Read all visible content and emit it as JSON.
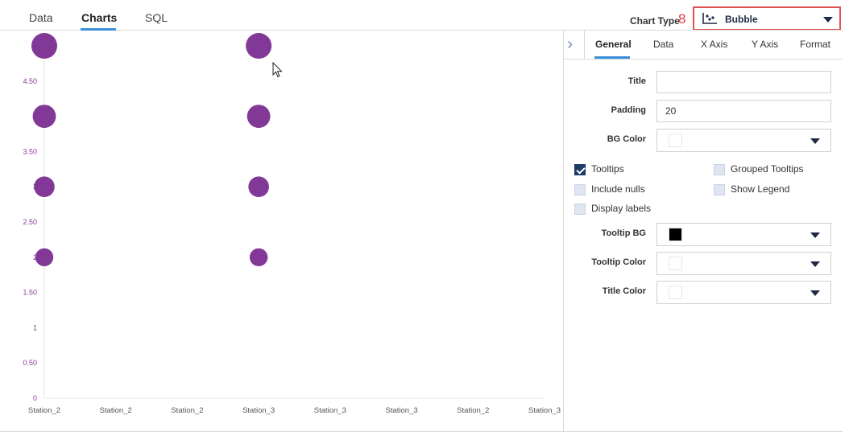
{
  "top_tabs": [
    {
      "label": "Data",
      "active": false
    },
    {
      "label": "Charts",
      "active": true
    },
    {
      "label": "SQL",
      "active": false
    }
  ],
  "chart_type": {
    "label": "Chart Type",
    "step_badge": "8",
    "icon": "scatter-chart-icon",
    "value": "Bubble"
  },
  "panel": {
    "collapse_icon": "double-chevron-right-icon",
    "tabs": [
      {
        "label": "General",
        "active": true
      },
      {
        "label": "Data",
        "active": false
      },
      {
        "label": "X Axis",
        "active": false
      },
      {
        "label": "Y Axis",
        "active": false
      },
      {
        "label": "Format",
        "active": false
      }
    ],
    "fields": {
      "title": {
        "label": "Title",
        "value": ""
      },
      "padding": {
        "label": "Padding",
        "value": "20"
      },
      "bg_color": {
        "label": "BG Color",
        "color": "#ffffff"
      }
    },
    "checkboxes": {
      "tooltips": {
        "label": "Tooltips",
        "checked": true
      },
      "grouped_tooltips": {
        "label": "Grouped Tooltips",
        "checked": false
      },
      "include_nulls": {
        "label": "Include nulls",
        "checked": false
      },
      "show_legend": {
        "label": "Show Legend",
        "checked": false
      },
      "display_labels": {
        "label": "Display labels",
        "checked": false
      }
    },
    "colors": {
      "tooltip_bg": {
        "label": "Tooltip BG",
        "color": "#000000"
      },
      "tooltip_color": {
        "label": "Tooltip Color",
        "color": "#ffffff"
      },
      "title_color": {
        "label": "Title Color",
        "color": "#ffffff"
      }
    }
  },
  "theme": {
    "accent": "#3a8ed8",
    "bubble": "#7b2d91",
    "axis_text": "#8a3a9a",
    "highlight": "#e05252"
  },
  "chart_data": {
    "type": "scatter",
    "categories": [
      "Station_2",
      "Station_2",
      "Station_2",
      "Station_3",
      "Station_3",
      "Station_3",
      "Station_2",
      "Station_3"
    ],
    "ylim": [
      0,
      5
    ],
    "y_ticks": [
      "0",
      "0.50",
      "1",
      "1.50",
      "2",
      "2.50",
      "3",
      "3.50",
      "4",
      "4.50",
      "5"
    ],
    "grid": false,
    "series": [
      {
        "points": [
          {
            "x": 0,
            "y": 5,
            "size": 5
          },
          {
            "x": 0,
            "y": 4,
            "size": 4
          },
          {
            "x": 0,
            "y": 3,
            "size": 3
          },
          {
            "x": 0,
            "y": 2,
            "size": 2
          },
          {
            "x": 3,
            "y": 5,
            "size": 5
          },
          {
            "x": 3,
            "y": 4,
            "size": 4
          },
          {
            "x": 3,
            "y": 3,
            "size": 3
          },
          {
            "x": 3,
            "y": 2,
            "size": 2
          }
        ]
      }
    ]
  }
}
